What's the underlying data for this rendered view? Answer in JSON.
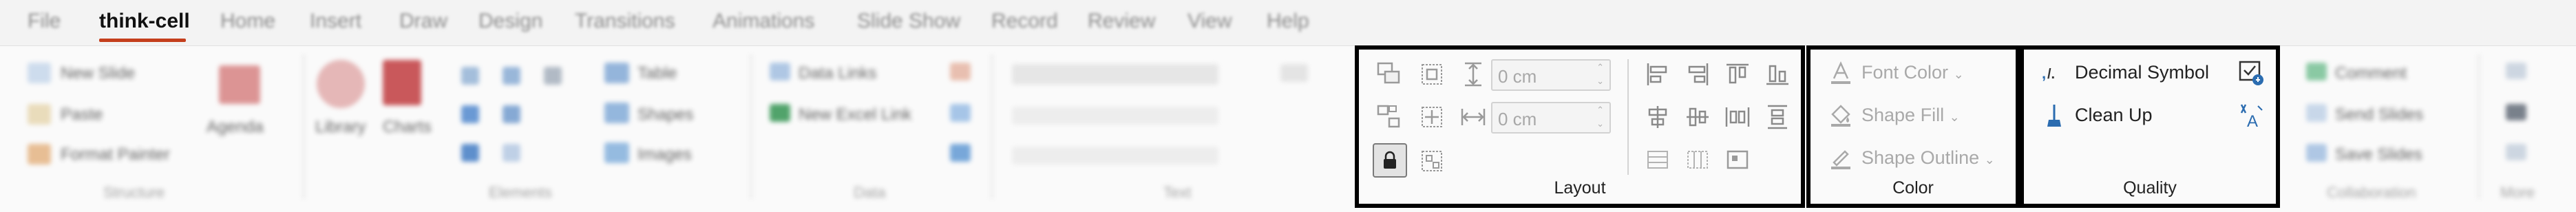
{
  "tabs": [
    "File",
    "think-cell",
    "Home",
    "Insert",
    "Draw",
    "Design",
    "Transitions",
    "Animations",
    "Slide Show",
    "Record",
    "Review",
    "View",
    "Help"
  ],
  "active_tab": "think-cell",
  "blurred_ribbon": {
    "items": [
      "New Slide",
      "Paste",
      "Format Painter",
      "Agenda",
      "Library",
      "Charts",
      "Table",
      "Shapes",
      "Images",
      "Data Links",
      "New Excel Link",
      "Comment",
      "Send Slides",
      "Save Slides"
    ],
    "groups": [
      "Structure",
      "Elements",
      "Data",
      "Text",
      "Collaboration",
      "More"
    ]
  },
  "layout_group": {
    "label": "Layout",
    "spin1_value": "0 cm",
    "spin2_value": "0 cm"
  },
  "color_group": {
    "label": "Color",
    "font_color": "Font Color",
    "shape_fill": "Shape Fill",
    "shape_outline": "Shape Outline"
  },
  "quality_group": {
    "label": "Quality",
    "decimal_symbol": "Decimal Symbol",
    "clean_up": "Clean Up"
  },
  "colors": {
    "accent": "#c43e1c",
    "icon_blue": "#2b6cb0",
    "disabled": "#a9a9a9"
  }
}
